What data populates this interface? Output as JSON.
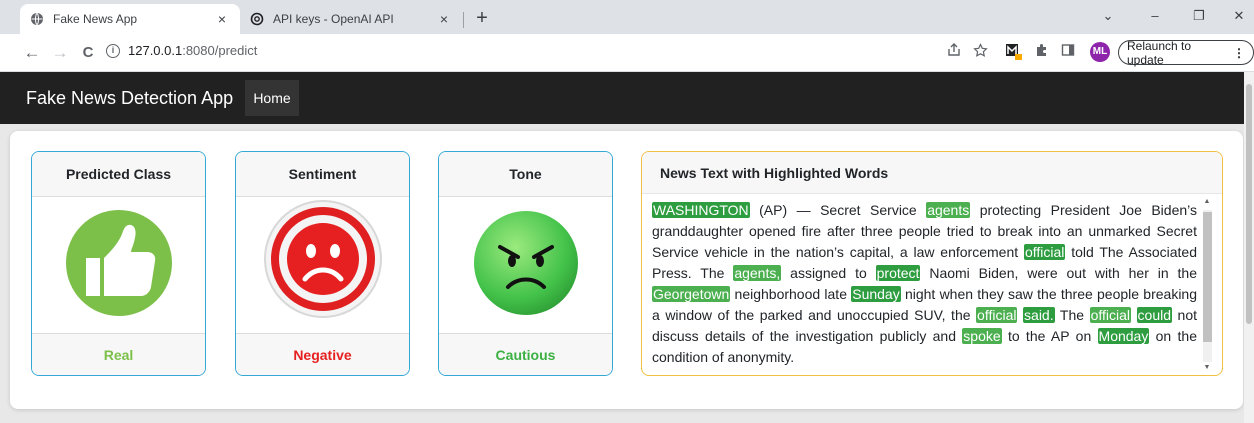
{
  "browser": {
    "tabs": [
      {
        "label": "Fake News App",
        "icon": "globe-icon"
      },
      {
        "label": "API keys - OpenAI API",
        "icon": "openai-icon"
      }
    ],
    "close_glyph": "×",
    "new_tab_glyph": "+",
    "window_controls": {
      "dropdown": "⌄",
      "minimize": "–",
      "restore": "❐",
      "close": "✕"
    },
    "nav": {
      "back": "←",
      "forward": "→",
      "reload": "C"
    },
    "url_host": "127.0.0.1",
    "url_path": ":8080/predict",
    "info_glyph": "i",
    "avatar_initials": "ML",
    "relaunch_label": "Relaunch to update",
    "menu_glyph": "⋮"
  },
  "app": {
    "brand": "Fake News Detection App",
    "nav_home": "Home"
  },
  "cards": {
    "predicted": {
      "header": "Predicted Class",
      "value": "Real",
      "color": "#7cc04a"
    },
    "sentiment": {
      "header": "Sentiment",
      "value": "Negative",
      "color": "#e62020"
    },
    "tone": {
      "header": "Tone",
      "value": "Cautious",
      "color": "#3cb043"
    }
  },
  "news": {
    "header": "News Text with Highlighted Words",
    "segments": [
      {
        "t": "WASHINGTON",
        "h": true
      },
      {
        "t": " (AP) — Secret Service ",
        "h": false
      },
      {
        "t": "agents",
        "h": true
      },
      {
        "t": " protecting President Joe Biden’s granddaughter opened fire after three people tried to break into an unmarked Secret Service vehicle in the nation’s capital, a law enforcement ",
        "h": false
      },
      {
        "t": "official",
        "h": true
      },
      {
        "t": " told The Associated Press. The ",
        "h": false
      },
      {
        "t": "agents,",
        "h": true
      },
      {
        "t": " assigned to ",
        "h": false
      },
      {
        "t": "protect",
        "h": true
      },
      {
        "t": " Naomi Biden, were out with her in the ",
        "h": false
      },
      {
        "t": "Georgetown",
        "h": true
      },
      {
        "t": " neighborhood late ",
        "h": false
      },
      {
        "t": "Sunday",
        "h": true
      },
      {
        "t": " night when they saw the three people breaking a window of the parked and unoccupied SUV, the ",
        "h": false
      },
      {
        "t": "official",
        "h": true
      },
      {
        "t": " ",
        "h": false
      },
      {
        "t": "said.",
        "h": true
      },
      {
        "t": " The ",
        "h": false
      },
      {
        "t": "official",
        "h": true
      },
      {
        "t": " ",
        "h": false
      },
      {
        "t": "could",
        "h": true
      },
      {
        "t": " not discuss details of the investigation publicly and ",
        "h": false
      },
      {
        "t": "spoke",
        "h": true
      },
      {
        "t": " to the AP on ",
        "h": false
      },
      {
        "t": "Monday",
        "h": true
      },
      {
        "t": " on the condition of anonymity.",
        "h": false
      }
    ]
  }
}
